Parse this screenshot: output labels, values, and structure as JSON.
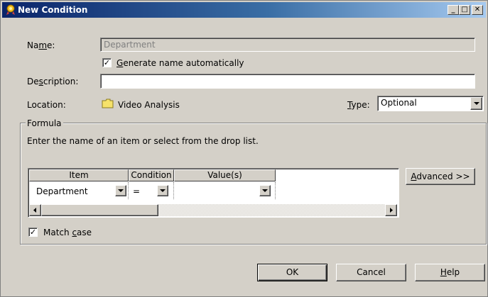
{
  "window": {
    "title": "New Condition",
    "minimize_label": "_",
    "maximize_label": "□",
    "close_label": "✕"
  },
  "form": {
    "name_label_pre": "Na",
    "name_label_u": "m",
    "name_label_post": "e:",
    "name_value": "Department",
    "generate_checked": "✓",
    "generate_label_u": "G",
    "generate_label_rest": "enerate name automatically",
    "description_label_pre": "De",
    "description_label_u": "s",
    "description_label_post": "cription:",
    "description_value": "",
    "location_label": "Location:",
    "location_value": "Video Analysis",
    "type_label_u": "T",
    "type_label_rest": "ype:",
    "type_value": "Optional"
  },
  "formula": {
    "legend": "Formula",
    "instructions": "Enter the name of an item or select from the drop list.",
    "columns": [
      "Item",
      "Condition",
      "Value(s)"
    ],
    "row": {
      "item": "Department",
      "condition": "=",
      "value": ""
    },
    "advanced_label_u": "A",
    "advanced_label_rest": "dvanced >>",
    "match_case_checked": "✓",
    "match_case_pre": "Match ",
    "match_case_u": "c",
    "match_case_post": "ase"
  },
  "buttons": {
    "ok": "OK",
    "cancel": "Cancel",
    "help_u": "H",
    "help_rest": "elp"
  }
}
